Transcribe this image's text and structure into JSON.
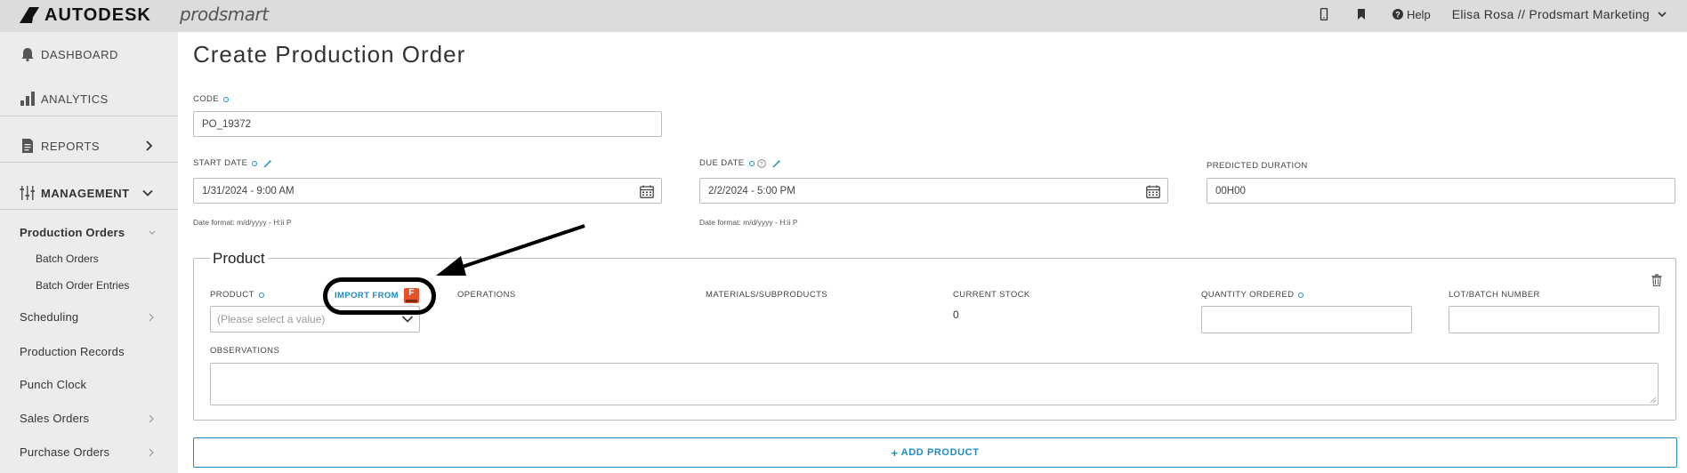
{
  "topbar": {
    "logo_text": "AUTODESK",
    "product_name": "prodsmart",
    "help_label": "Help",
    "user_label": "Elisa Rosa // Prodsmart Marketing"
  },
  "sidebar": {
    "dashboard": "DASHBOARD",
    "analytics": "ANALYTICS",
    "reports": "REPORTS",
    "management": "MANAGEMENT",
    "items": [
      {
        "label": "Production Orders"
      },
      {
        "label": "Batch Orders"
      },
      {
        "label": "Batch Order Entries"
      },
      {
        "label": "Scheduling"
      },
      {
        "label": "Production Records"
      },
      {
        "label": "Punch Clock"
      },
      {
        "label": "Sales Orders"
      },
      {
        "label": "Purchase Orders"
      }
    ]
  },
  "page": {
    "title": "Create Production Order"
  },
  "form": {
    "code_label": "CODE",
    "code_value": "PO_19372",
    "start_date_label": "START DATE",
    "start_date_value": "1/31/2024 - 9:00 AM",
    "start_date_hint": "Date format: m/d/yyyy - H:ii P",
    "due_date_label": "DUE DATE",
    "due_date_value": "2/2/2024 - 5:00 PM",
    "due_date_hint": "Date format: m/d/yyyy - H:ii P",
    "predicted_duration_label": "PREDICTED DURATION",
    "predicted_duration_value": "00H00"
  },
  "product_section": {
    "legend": "Product",
    "product_label": "PRODUCT",
    "import_label": "IMPORT FROM",
    "import_badge": "F",
    "operations_label": "OPERATIONS",
    "materials_label": "MATERIALS/SUBPRODUCTS",
    "current_stock_label": "CURRENT STOCK",
    "current_stock_value": "0",
    "quantity_label": "QUANTITY ORDERED",
    "lot_label": "LOT/BATCH NUMBER",
    "product_placeholder": "(Please select a value)",
    "observations_label": "OBSERVATIONS"
  },
  "actions": {
    "add_product": "ADD PRODUCT"
  }
}
